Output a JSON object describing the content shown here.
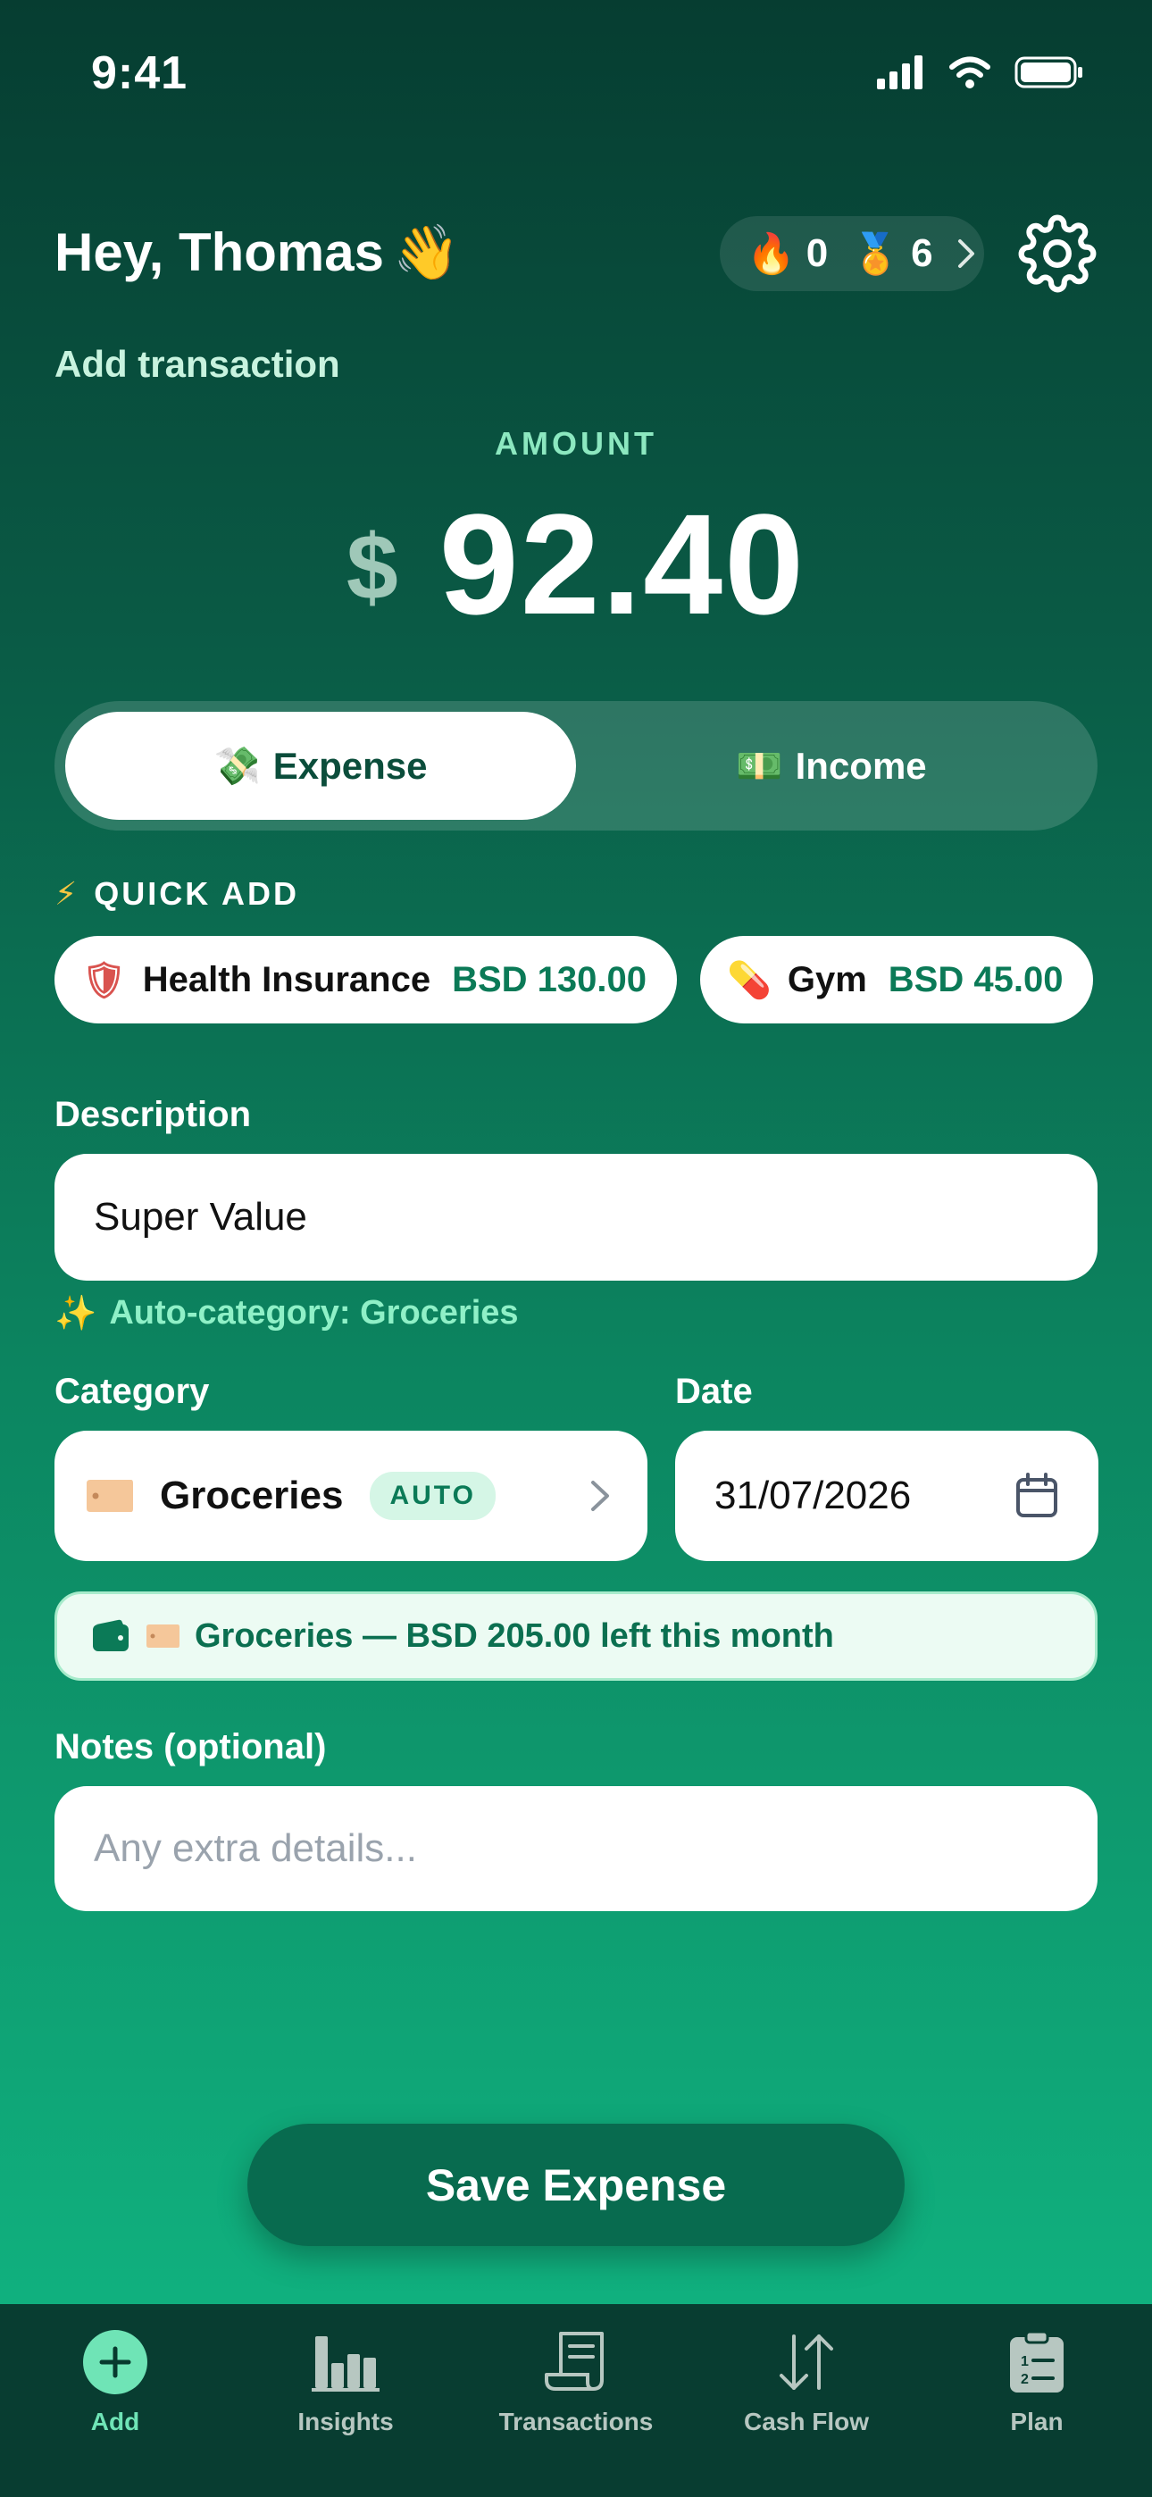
{
  "status_bar": {
    "time": "9:41"
  },
  "header": {
    "greeting": "Hey, Thomas",
    "greeting_emoji": "👋",
    "streak_icon": "🔥",
    "streak_count": "0",
    "medal_icon": "🏅",
    "medal_count": "6"
  },
  "page": {
    "subtitle": "Add transaction"
  },
  "amount": {
    "label": "AMOUNT",
    "currency": "$",
    "value": "92.40"
  },
  "type_toggle": {
    "expense_icon": "💸",
    "expense_label": "Expense",
    "income_icon": "💵",
    "income_label": "Income",
    "selected": "Expense"
  },
  "quick_add": {
    "title": "QUICK ADD",
    "icon": "⚡",
    "items": [
      {
        "icon": "🛡",
        "name": "Health Insurance",
        "amount": "BSD 130.00"
      },
      {
        "icon": "💊",
        "name": "Gym",
        "amount": "BSD 45.00"
      }
    ]
  },
  "description": {
    "label": "Description",
    "value": "Super Value"
  },
  "auto_category": {
    "icon": "✨",
    "text": "Auto-category: Groceries"
  },
  "category": {
    "label": "Category",
    "icon": "🏷",
    "value": "Groceries",
    "badge": "AUTO"
  },
  "date": {
    "label": "Date",
    "value": "31/07/2026"
  },
  "budget": {
    "icon": "🏷",
    "text": "Groceries — BSD 205.00 left this month"
  },
  "notes": {
    "label": "Notes (optional)",
    "placeholder": "Any extra details..."
  },
  "save_button": {
    "label": "Save Expense"
  },
  "tabs": [
    {
      "label": "Add",
      "icon": "plus-circle-icon",
      "active": true
    },
    {
      "label": "Insights",
      "icon": "bar-chart-icon",
      "active": false
    },
    {
      "label": "Transactions",
      "icon": "receipt-icon",
      "active": false
    },
    {
      "label": "Cash Flow",
      "icon": "arrows-updown-icon",
      "active": false
    },
    {
      "label": "Plan",
      "icon": "clipboard-list-icon",
      "active": false
    }
  ],
  "colors": {
    "accent": "#10b07e",
    "dark": "#063d31",
    "mint": "#8ff0c7",
    "button": "#086b4f"
  }
}
